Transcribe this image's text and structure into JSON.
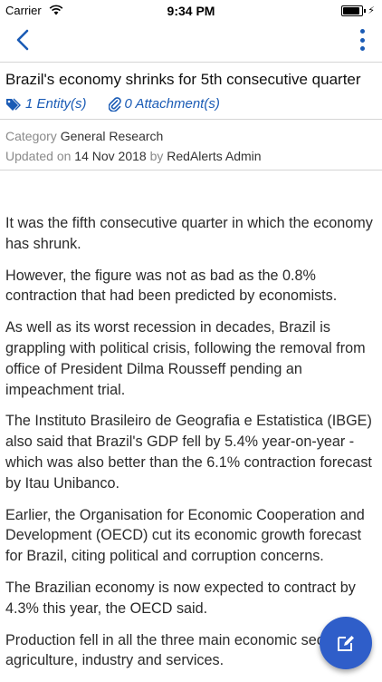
{
  "status_bar": {
    "carrier": "Carrier",
    "time": "9:34 PM",
    "battery_level": 0.95,
    "icons": [
      "wifi-icon",
      "battery-icon",
      "charging-bolt-icon"
    ]
  },
  "nav": {
    "back_icon": "chevron-left-icon",
    "more_icon": "more-vertical-icon",
    "accent_color": "#1a5bb5"
  },
  "article": {
    "title": "Brazil's economy shrinks for 5th consecutive quarter",
    "entities_label": "1 Entity(s)",
    "attachments_label": "0 Attachment(s)",
    "category_label": "Category",
    "category_value": "General Research",
    "updated_label": "Updated on",
    "updated_date": "14 Nov 2018",
    "by_label": "by",
    "author": "RedAlerts Admin",
    "paragraphs": [
      "It was the fifth consecutive quarter in which the economy has shrunk.",
      "However, the figure was not as bad as the 0.8% contraction that had been predicted by economists.",
      "As well as its worst recession in decades, Brazil is grappling with political crisis, following the removal from office of President Dilma Rousseff pending an impeachment trial.",
      "The Instituto Brasileiro de Geografia e Estatistica (IBGE) also said that Brazil's GDP fell by 5.4% year-on-year - which was also better than the 6.1% contraction forecast by Itau Unibanco.",
      "Earlier, the Organisation for Economic Cooperation and Development (OECD) cut its economic growth forecast for Brazil, citing political and corruption concerns.",
      "The Brazilian economy is now expected to contract by 4.3% this year, the OECD said.",
      "Production fell in all the three main economic sectors - agriculture, industry and services."
    ]
  },
  "fab": {
    "icon": "edit-icon",
    "color": "#2f5ec9"
  }
}
